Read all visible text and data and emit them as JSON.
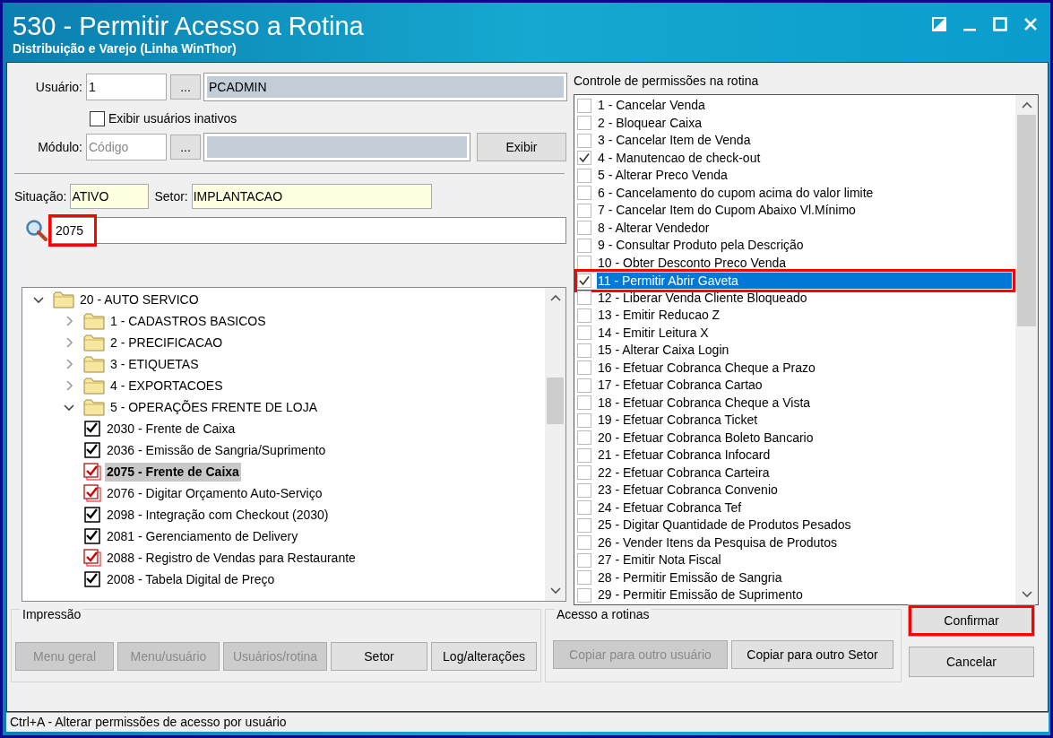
{
  "window": {
    "title": "530 - Permitir Acesso a Rotina",
    "subtitle": "Distribuição e Varejo (Linha WinThor)"
  },
  "user": {
    "label": "Usuário:",
    "code": "1",
    "lookup": "...",
    "name": "PCADMIN"
  },
  "show_inactive": {
    "label": "Exibir usuários inativos",
    "checked": false
  },
  "module": {
    "label": "Módulo:",
    "placeholder": "Código",
    "lookup": "...",
    "button": "Exibir"
  },
  "situation": {
    "label": "Situação:",
    "value": "ATIVO"
  },
  "sector": {
    "label": "Setor:",
    "value": "IMPLANTACAO"
  },
  "search": {
    "value": "2075",
    "highlighted": true
  },
  "tree": [
    {
      "kind": "folder",
      "label": "20 - AUTO SERVICO",
      "expanded": true,
      "children": [
        {
          "kind": "folder",
          "label": "1 - CADASTROS BASICOS",
          "expanded": false
        },
        {
          "kind": "folder",
          "label": "2 - PRECIFICACAO",
          "expanded": false
        },
        {
          "kind": "folder",
          "label": "3 - ETIQUETAS",
          "expanded": false
        },
        {
          "kind": "folder",
          "label": "4 - EXPORTACOES",
          "expanded": false
        },
        {
          "kind": "folder",
          "label": "5 - OPERAÇÕES FRENTE DE LOJA",
          "expanded": true,
          "children": [
            {
              "kind": "routine",
              "label": "2030 - Frente de Caixa",
              "checked": true,
              "changed": false,
              "selected": false
            },
            {
              "kind": "routine",
              "label": "2036 - Emissão de Sangria/Suprimento",
              "checked": true,
              "changed": false,
              "selected": false
            },
            {
              "kind": "routine",
              "label": "2075 - Frente de Caixa",
              "checked": true,
              "changed": true,
              "selected": true
            },
            {
              "kind": "routine",
              "label": "2076 - Digitar Orçamento Auto-Serviço",
              "checked": true,
              "changed": true,
              "selected": false
            },
            {
              "kind": "routine",
              "label": "2098 - Integração com Checkout (2030)",
              "checked": true,
              "changed": false,
              "selected": false
            },
            {
              "kind": "routine",
              "label": "2081 - Gerenciamento de Delivery",
              "checked": true,
              "changed": false,
              "selected": false
            },
            {
              "kind": "routine",
              "label": "2088 - Registro de Vendas para Restaurante",
              "checked": true,
              "changed": true,
              "selected": false
            },
            {
              "kind": "routine",
              "label": "2008 - Tabela Digital de Preço",
              "checked": true,
              "changed": false,
              "selected": false
            }
          ]
        }
      ]
    }
  ],
  "permissions": {
    "title": "Controle de permissões na rotina",
    "items": [
      {
        "label": "1 - Cancelar Venda",
        "checked": false,
        "selected": false
      },
      {
        "label": "2 - Bloquear Caixa",
        "checked": false,
        "selected": false
      },
      {
        "label": "3 - Cancelar Item de Venda",
        "checked": false,
        "selected": false
      },
      {
        "label": "4 - Manutencao de check-out",
        "checked": true,
        "selected": false
      },
      {
        "label": "5 - Alterar Preco Venda",
        "checked": false,
        "selected": false
      },
      {
        "label": "6 - Cancelamento do cupom acima do valor limite",
        "checked": false,
        "selected": false
      },
      {
        "label": "7 - Cancelar Item do Cupom Abaixo Vl.Mínimo",
        "checked": false,
        "selected": false
      },
      {
        "label": "8 - Alterar Vendedor",
        "checked": false,
        "selected": false
      },
      {
        "label": "9 - Consultar Produto pela Descrição",
        "checked": false,
        "selected": false
      },
      {
        "label": "10 - Obter Desconto Preco Venda",
        "checked": false,
        "selected": false
      },
      {
        "label": "11 - Permitir Abrir Gaveta",
        "checked": true,
        "selected": true,
        "highlighted": true
      },
      {
        "label": "12 - Liberar Venda Cliente Bloqueado",
        "checked": false,
        "selected": false
      },
      {
        "label": "13 - Emitir Reducao Z",
        "checked": false,
        "selected": false
      },
      {
        "label": "14 - Emitir Leitura X",
        "checked": false,
        "selected": false
      },
      {
        "label": "15 - Alterar Caixa Login",
        "checked": false,
        "selected": false
      },
      {
        "label": "16 - Efetuar Cobranca Cheque a Prazo",
        "checked": false,
        "selected": false
      },
      {
        "label": "17 - Efetuar Cobranca Cartao",
        "checked": false,
        "selected": false
      },
      {
        "label": "18 - Efetuar Cobranca Cheque a Vista",
        "checked": false,
        "selected": false
      },
      {
        "label": "19 - Efetuar Cobranca Ticket",
        "checked": false,
        "selected": false
      },
      {
        "label": "20 - Efetuar Cobranca Boleto Bancario",
        "checked": false,
        "selected": false
      },
      {
        "label": "21 - Efetuar Cobranca Infocard",
        "checked": false,
        "selected": false
      },
      {
        "label": "22 - Efetuar Cobranca Carteira",
        "checked": false,
        "selected": false
      },
      {
        "label": "23 - Efetuar Cobranca Convenio",
        "checked": false,
        "selected": false
      },
      {
        "label": "24 - Efetuar Cobranca Tef",
        "checked": false,
        "selected": false
      },
      {
        "label": "25 - Digitar Quantidade de Produtos Pesados",
        "checked": false,
        "selected": false
      },
      {
        "label": "26 - Vender Itens da Pesquisa de Produtos",
        "checked": false,
        "selected": false
      },
      {
        "label": "27 - Emitir Nota Fiscal",
        "checked": false,
        "selected": false
      },
      {
        "label": "28 - Permitir Emissão de Sangria",
        "checked": false,
        "selected": false
      },
      {
        "label": "29 - Permitir Emissão de Suprimento",
        "checked": false,
        "selected": false
      }
    ]
  },
  "print_group": {
    "title": "Impressão",
    "buttons": [
      {
        "label": "Menu geral",
        "disabled": true
      },
      {
        "label": "Menu/usuário",
        "disabled": true
      },
      {
        "label": "Usuários/rotina",
        "disabled": true
      },
      {
        "label": "Setor",
        "disabled": false
      },
      {
        "label": "Log/alterações",
        "disabled": false
      }
    ]
  },
  "access_group": {
    "title": "Acesso a rotinas",
    "buttons": [
      {
        "label": "Copiar para outro usuário",
        "disabled": true
      },
      {
        "label": "Copiar para outro Setor",
        "disabled": false
      }
    ]
  },
  "actions": [
    {
      "label": "Confirmar",
      "highlighted": true
    },
    {
      "label": "Cancelar",
      "highlighted": false
    }
  ],
  "status_bar": "Ctrl+A - Alterar permissões de acesso por usuário"
}
